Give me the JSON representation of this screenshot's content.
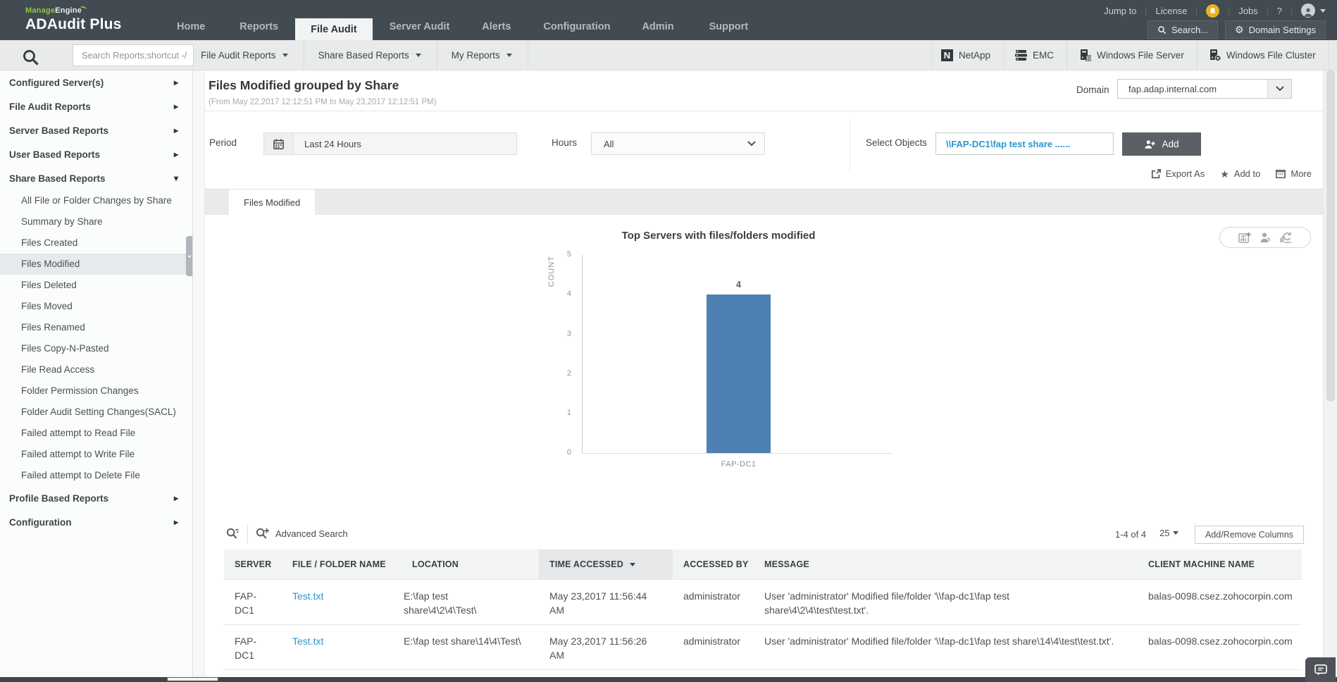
{
  "brand": {
    "manage": "Manage",
    "engine": "Engine",
    "product": "ADAudit Plus"
  },
  "topnav": {
    "items": [
      "Home",
      "Reports",
      "File Audit",
      "Server Audit",
      "Alerts",
      "Configuration",
      "Admin",
      "Support"
    ],
    "active": "File Audit"
  },
  "utility": {
    "jump_to": "Jump to",
    "license": "License",
    "jobs": "Jobs",
    "help": "?",
    "search_label": "Search...",
    "domain_settings_label": "Domain Settings"
  },
  "toolbar": {
    "search_placeholder": "Search Reports;shortcut -/",
    "menus": [
      "File Audit Reports",
      "Share Based Reports",
      "My Reports"
    ],
    "server_types": [
      "NetApp",
      "EMC",
      "Windows File Server",
      "Windows File Cluster"
    ]
  },
  "sidebar": {
    "groups": [
      {
        "label": "Configured Server(s)"
      },
      {
        "label": "File Audit Reports"
      },
      {
        "label": "Server Based Reports"
      },
      {
        "label": "User Based Reports"
      },
      {
        "label": "Share Based Reports",
        "expanded": true,
        "items": [
          {
            "label": "All File or Folder Changes by Share"
          },
          {
            "label": "Summary by Share"
          },
          {
            "label": "Files Created"
          },
          {
            "label": "Files Modified",
            "selected": true
          },
          {
            "label": "Files Deleted"
          },
          {
            "label": "Files Moved"
          },
          {
            "label": "Files Renamed"
          },
          {
            "label": "Files Copy-N-Pasted"
          },
          {
            "label": "File Read Access"
          },
          {
            "label": "Folder Permission Changes"
          },
          {
            "label": "Folder Audit Setting Changes(SACL)"
          },
          {
            "label": "Failed attempt to Read File"
          },
          {
            "label": "Failed attempt to Write File"
          },
          {
            "label": "Failed attempt to Delete File"
          }
        ]
      },
      {
        "label": "Profile Based Reports"
      },
      {
        "label": "Configuration"
      }
    ]
  },
  "report": {
    "title": "Files Modified grouped by Share",
    "range": "(From May 22,2017 12:12:51 PM to May 23,2017 12:12:51 PM)",
    "domain_label": "Domain",
    "domain_value": "fap.adap.internal.com",
    "period_label": "Period",
    "period_value": "Last 24 Hours",
    "hours_label": "Hours",
    "hours_value": "All",
    "select_objects_label": "Select Objects",
    "select_objects_value": "\\\\FAP-DC1\\fap test share ......",
    "add_label": "Add",
    "export_as": "Export As",
    "add_to": "Add to",
    "more": "More",
    "tab": "Files Modified"
  },
  "chart_data": {
    "type": "bar",
    "title": "Top Servers with files/folders modified",
    "categories": [
      "FAP-DC1"
    ],
    "values": [
      4
    ],
    "xlabel": "",
    "ylabel": "COUNT",
    "ylim": [
      0,
      5
    ],
    "yticks": [
      "5",
      "4",
      "3",
      "2",
      "1",
      "0"
    ],
    "bar_color": "#4d81b5",
    "grid": false,
    "legend": false,
    "value_labels": true
  },
  "table": {
    "advanced_search": "Advanced Search",
    "pagination": "1-4 of 4",
    "page_size": "25",
    "add_remove_columns": "Add/Remove Columns",
    "columns": [
      "SERVER",
      "FILE / FOLDER NAME",
      "LOCATION",
      "TIME ACCESSED",
      "ACCESSED BY",
      "MESSAGE",
      "CLIENT MACHINE NAME"
    ],
    "sorted_column": "TIME ACCESSED",
    "rows": [
      {
        "server": "FAP-DC1",
        "file": "Test.txt",
        "location": "E:\\fap test share\\4\\2\\4\\Test\\",
        "time": "May 23,2017 11:56:44 AM",
        "accessed_by": "administrator",
        "message": "User 'administrator' Modified file/folder '\\\\fap-dc1\\fap test share\\4\\2\\4\\test\\test.txt'.",
        "client": "balas-0098.csez.zohocorpin.com"
      },
      {
        "server": "FAP-DC1",
        "file": "Test.txt",
        "location": "E:\\fap test share\\14\\4\\Test\\",
        "time": "May 23,2017 11:56:26 AM",
        "accessed_by": "administrator",
        "message": "User 'administrator' Modified file/folder '\\\\fap-dc1\\fap test share\\14\\4\\test\\test.txt'.",
        "client": "balas-0098.csez.zohocorpin.com"
      }
    ]
  }
}
